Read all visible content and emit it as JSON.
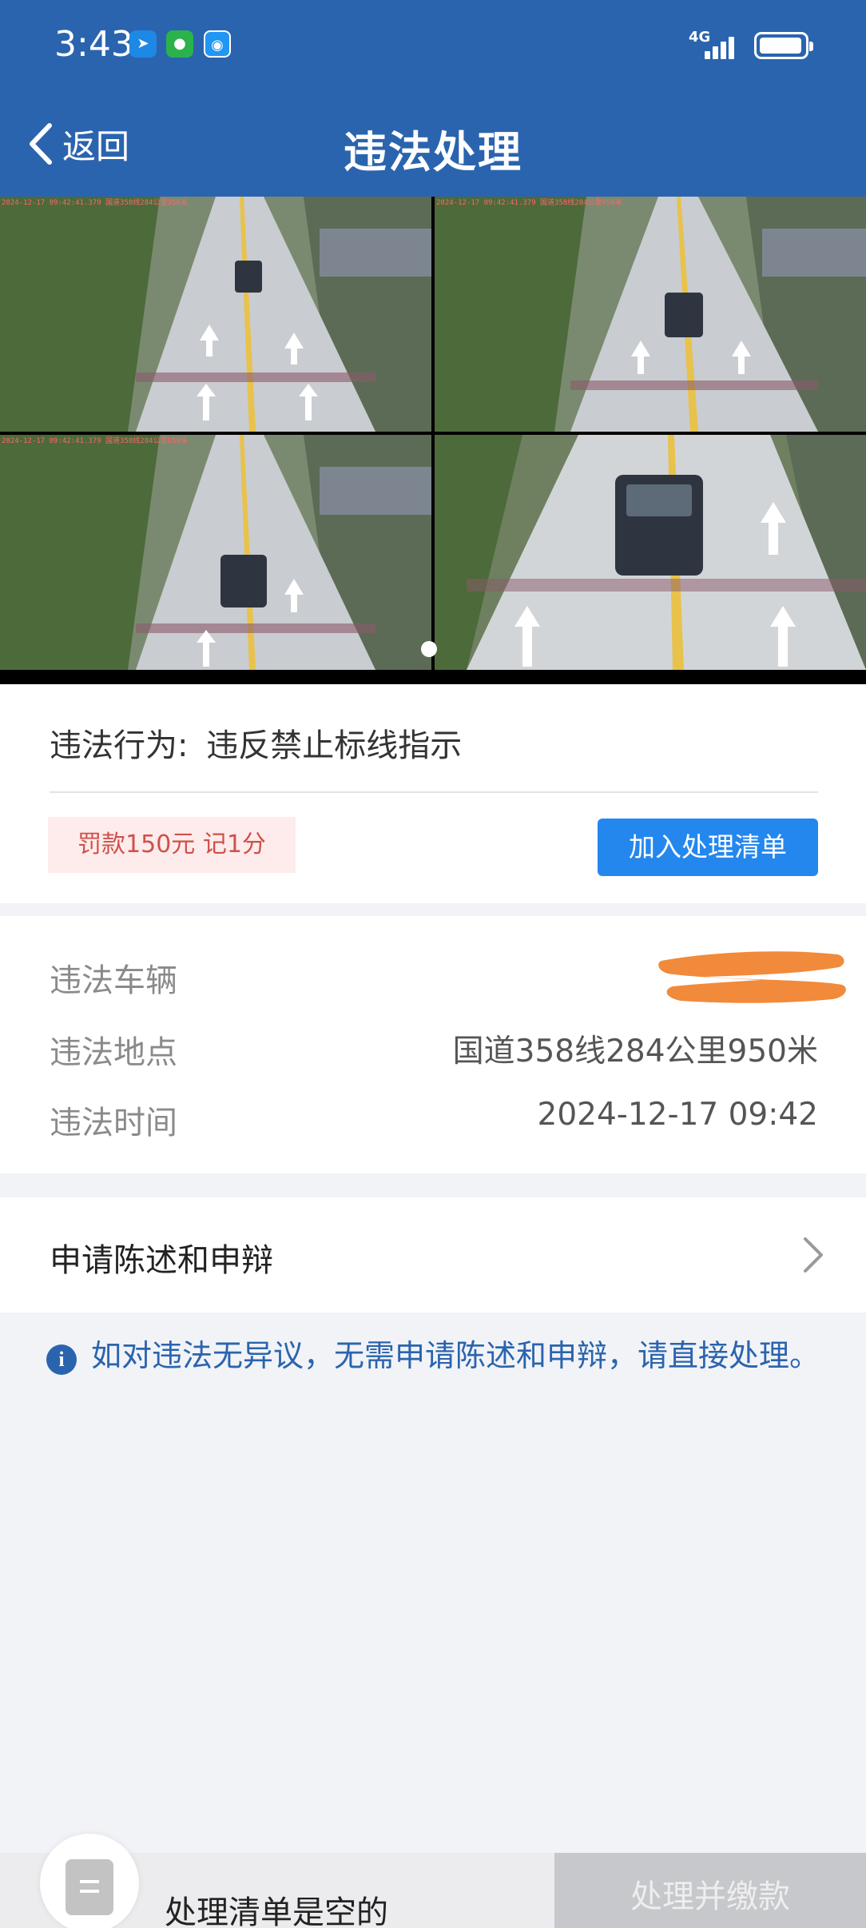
{
  "status_bar": {
    "time": "3:43",
    "network": "4G",
    "apps": [
      "app-icon",
      "wechat-icon",
      "browser-icon"
    ]
  },
  "nav": {
    "back_label": "返回",
    "title": "违法处理"
  },
  "photos": {
    "count": 4,
    "overlay_text": [
      "2024-12-17 09:42:41.379 国道358线284公里950米",
      "2024-12-17 09:42:41.379 国道358线284公里950米",
      "2024-12-17 09:42:41.379 国道358线284公里950米",
      ""
    ],
    "active_page": 1,
    "total_pages": 1
  },
  "violation": {
    "behavior_label": "违法行为:",
    "behavior": "违反禁止标线指示",
    "penalty": "罚款150元 记1分",
    "add_button": "加入处理清单"
  },
  "details": {
    "rows": [
      {
        "label": "违法车辆",
        "value": ""
      },
      {
        "label": "违法地点",
        "value": "国道358线284公里950米"
      },
      {
        "label": "违法时间",
        "value": "2024-12-17 09:42"
      }
    ]
  },
  "appeal": {
    "label": "申请陈述和申辩"
  },
  "info": {
    "text": "如对违法无异议，无需申请陈述和申辩，请直接处理。"
  },
  "bottom": {
    "cart_text": "处理清单是空的",
    "pay_button": "处理并缴款"
  },
  "colors": {
    "header": "#2a64ae",
    "accent_button": "#2487ee",
    "penalty_text": "#d0504a",
    "penalty_bg": "#fdeceb",
    "redaction": "#f18a3a"
  }
}
